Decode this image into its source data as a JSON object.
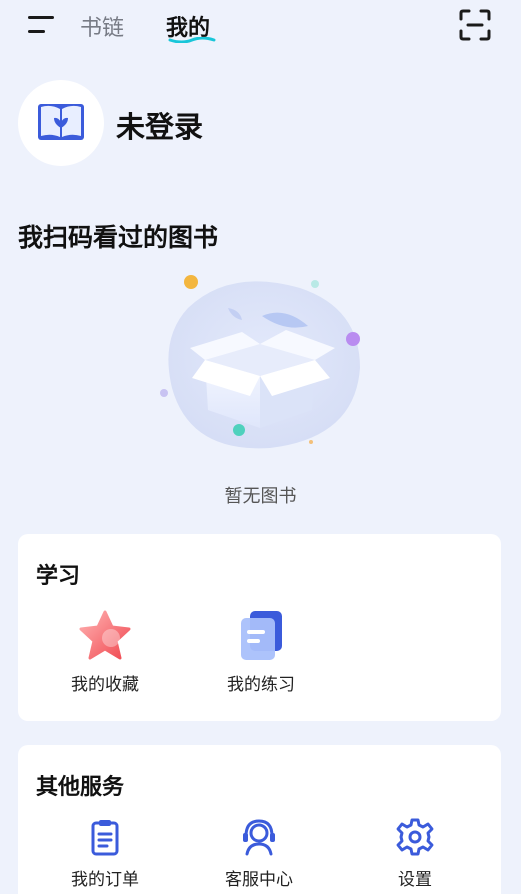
{
  "header": {
    "tabs": [
      {
        "label": "书链",
        "active": false
      },
      {
        "label": "我的",
        "active": true
      }
    ],
    "icons": {
      "menu": "menu-icon",
      "scan": "scan-icon"
    }
  },
  "profile": {
    "avatar_icon": "book-logo-icon",
    "login_status": "未登录"
  },
  "scanned_books": {
    "title": "我扫码看过的图书",
    "empty_text": "暂无图书"
  },
  "study": {
    "title": "学习",
    "items": [
      {
        "label": "我的收藏",
        "icon": "star-icon"
      },
      {
        "label": "我的练习",
        "icon": "document-icon"
      }
    ]
  },
  "other_services": {
    "title": "其他服务",
    "items": [
      {
        "label": "我的订单",
        "icon": "clipboard-icon"
      },
      {
        "label": "客服中心",
        "icon": "headset-icon"
      },
      {
        "label": "设置",
        "icon": "gear-icon"
      }
    ]
  },
  "colors": {
    "accent": "#3b5bdb",
    "background": "#eef2fc",
    "tab_underline": "#19c6d9"
  }
}
